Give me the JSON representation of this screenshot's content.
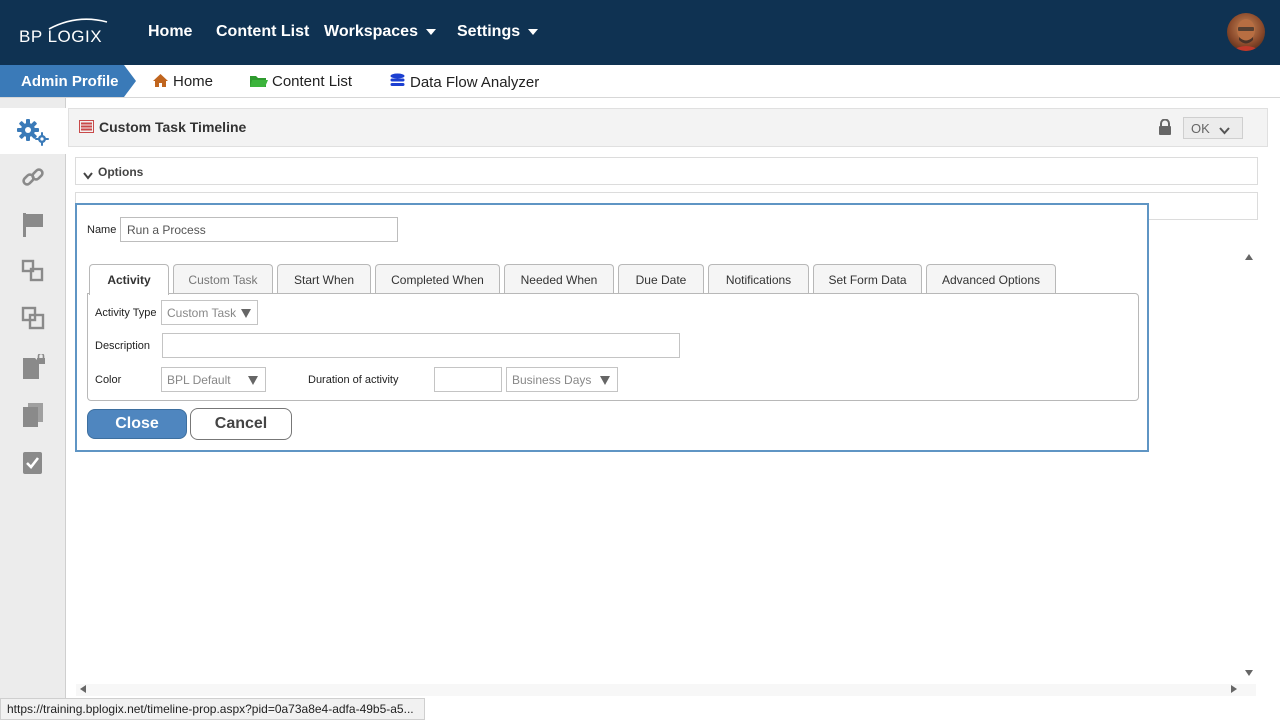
{
  "brand": {
    "logo_text": "BP LOGIX"
  },
  "topnav": {
    "items": [
      {
        "label": "Home",
        "has_caret": false
      },
      {
        "label": "Content List",
        "has_caret": false
      },
      {
        "label": "Workspaces",
        "has_caret": true
      },
      {
        "label": "Settings",
        "has_caret": true
      }
    ],
    "avatar_icon": "user-avatar"
  },
  "breadcrumb": {
    "profile": "Admin Profile",
    "links": [
      {
        "label": "Home",
        "icon": "home-icon"
      },
      {
        "label": "Content List",
        "icon": "folder-icon"
      },
      {
        "label": "Data Flow Analyzer",
        "icon": "database-icon"
      }
    ]
  },
  "sidebar": {
    "icons": [
      "gears-icon",
      "link-icon",
      "flag-icon",
      "workflow-icon",
      "copy-icon",
      "locked-document-icon",
      "documents-icon",
      "checklist-icon"
    ]
  },
  "panel": {
    "title": "Custom Task Timeline",
    "ok_label": "OK",
    "options_label": "Options"
  },
  "dialog": {
    "name_label": "Name",
    "name_value": "Run a Process",
    "tabs": [
      {
        "label": "Activity"
      },
      {
        "label": "Custom Task"
      },
      {
        "label": "Start When"
      },
      {
        "label": "Completed When"
      },
      {
        "label": "Needed When"
      },
      {
        "label": "Due Date"
      },
      {
        "label": "Notifications"
      },
      {
        "label": "Set Form Data"
      },
      {
        "label": "Advanced Options"
      }
    ],
    "activity_type_label": "Activity Type",
    "activity_type_value": "Custom Task",
    "description_label": "Description",
    "description_value": "",
    "color_label": "Color",
    "color_value": "BPL Default",
    "duration_label": "Duration of activity",
    "duration_value": "",
    "duration_unit": "Business Days",
    "close_label": "Close",
    "cancel_label": "Cancel"
  },
  "status_url": "https://training.bplogix.net/timeline-prop.aspx?pid=0a73a8e4-adfa-49b5-a5...",
  "colors": {
    "topnav_bg": "#0f3252",
    "admin_crumb_bg": "#3a7ab8",
    "dialog_border": "#5f95c4",
    "close_button_bg": "#4f86bf"
  }
}
